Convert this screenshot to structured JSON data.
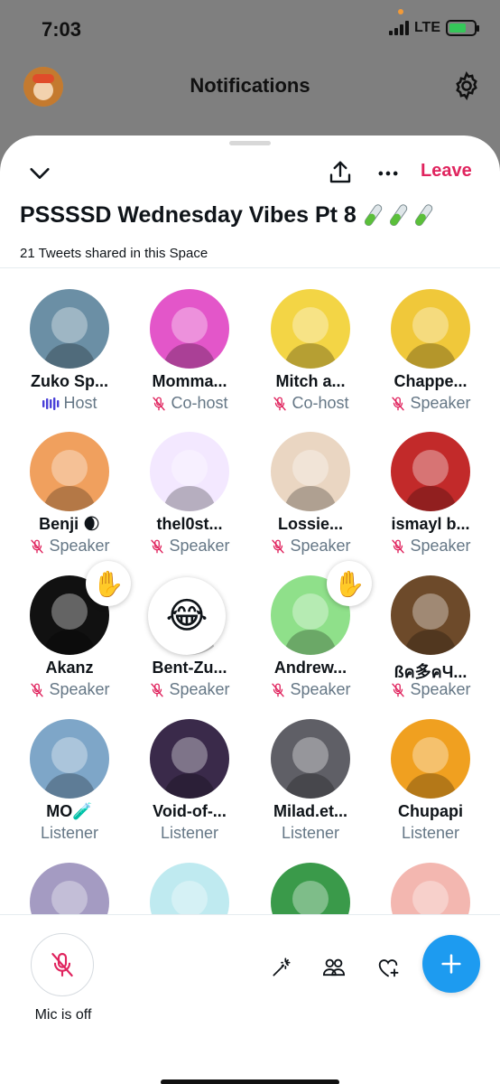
{
  "status_bar": {
    "time": "7:03",
    "network": "LTE"
  },
  "background_header": {
    "title": "Notifications"
  },
  "space": {
    "leave_label": "Leave",
    "title": "PSSSSD Wednesday Vibes Pt 8",
    "title_emoji": "🧪🧪🧪",
    "subtitle": "21 Tweets shared in this Space"
  },
  "participants": [
    {
      "name": "Zuko Sp...",
      "role": "Host",
      "role_icon": "audio-wave-icon",
      "color": "#6b8fa5"
    },
    {
      "name": "Momma...",
      "role": "Co-host",
      "role_icon": "mic-off-icon",
      "color": "#e356c9"
    },
    {
      "name": "Mitch a...",
      "role": "Co-host",
      "role_icon": "mic-off-icon",
      "color": "#f3d545"
    },
    {
      "name": "Chappe...",
      "role": "Speaker",
      "role_icon": "mic-off-icon",
      "color": "#f0c83a"
    },
    {
      "name": "Benji 🌒",
      "role": "Speaker",
      "role_icon": "mic-off-icon",
      "color": "#f0a05e"
    },
    {
      "name": "thel0st...",
      "role": "Speaker",
      "role_icon": "mic-off-icon",
      "color": "#f3e8ff"
    },
    {
      "name": "Lossie...",
      "role": "Speaker",
      "role_icon": "mic-off-icon",
      "color": "#ead6c2"
    },
    {
      "name": "ismayl b...",
      "role": "Speaker",
      "role_icon": "mic-off-icon",
      "color": "#c22a2a"
    },
    {
      "name": "Akanz",
      "role": "Speaker",
      "role_icon": "mic-off-icon",
      "color": "#111111",
      "reaction": "✋"
    },
    {
      "name": "Bent-Zu...",
      "role": "Speaker",
      "role_icon": "mic-off-icon",
      "color": "#ffffff",
      "reaction": "😂"
    },
    {
      "name": "Andrew...",
      "role": "Speaker",
      "role_icon": "mic-off-icon",
      "color": "#8fe08a",
      "reaction": "✋"
    },
    {
      "name": "ßค多คЧ...",
      "role": "Speaker",
      "role_icon": "mic-off-icon",
      "color": "#6d4a2a"
    },
    {
      "name": "MO🧪",
      "role": "Listener",
      "role_icon": "",
      "color": "#7ea6c8"
    },
    {
      "name": "Void-of-...",
      "role": "Listener",
      "role_icon": "",
      "color": "#3a2a4a"
    },
    {
      "name": "Milad.et...",
      "role": "Listener",
      "role_icon": "",
      "color": "#5f5f66"
    },
    {
      "name": "Chupapi",
      "role": "Listener",
      "role_icon": "",
      "color": "#f0a020"
    },
    {
      "name": "",
      "role": "",
      "role_icon": "",
      "color": "#a49bc2"
    },
    {
      "name": "",
      "role": "",
      "role_icon": "",
      "color": "#bfeaf0"
    },
    {
      "name": "",
      "role": "",
      "role_icon": "",
      "color": "#3a9a4a"
    },
    {
      "name": "",
      "role": "",
      "role_icon": "",
      "color": "#f3b7b0"
    }
  ],
  "bottom": {
    "mic_label": "Mic is off"
  },
  "colors": {
    "accent": "#1d9bf0",
    "leave": "#e0245e",
    "secondary_text": "#657786",
    "role_icon": "#e0245e",
    "host_icon": "#4a40d8"
  }
}
